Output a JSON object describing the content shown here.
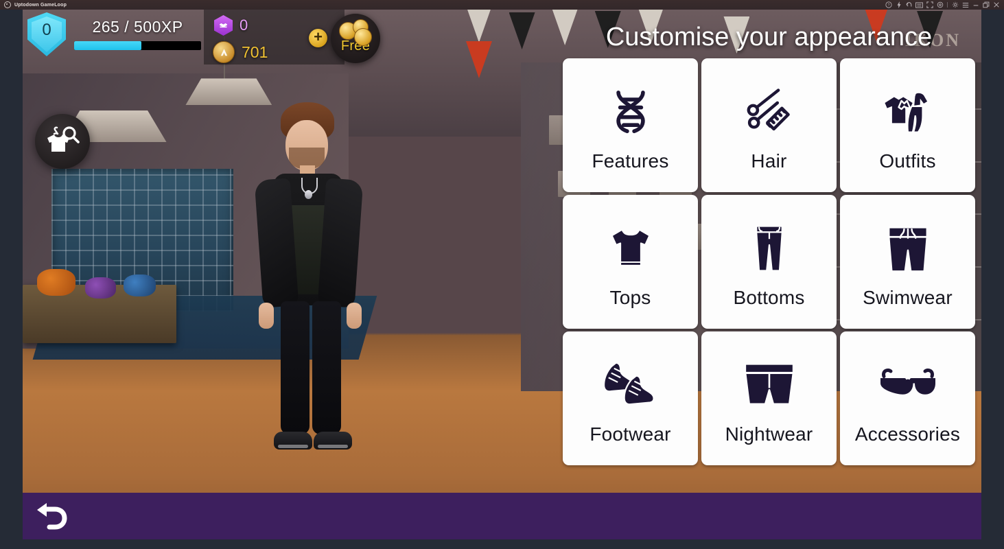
{
  "window": {
    "title": "Uptodown GameLoop",
    "logo_icon": "gameloop-logo-icon",
    "toolbar_icons": [
      {
        "name": "help-icon",
        "glyph": "?"
      },
      {
        "name": "flash-icon",
        "glyph": "lightning"
      },
      {
        "name": "back-arrow-icon",
        "glyph": "undo"
      },
      {
        "name": "keyboard-mapping-icon",
        "glyph": "keyboard"
      },
      {
        "name": "fullscreen-icon",
        "glyph": "expand"
      },
      {
        "name": "settings-icon",
        "glyph": "gear"
      },
      {
        "name": "pin-icon",
        "glyph": "pin"
      },
      {
        "name": "menu-icon",
        "glyph": "menu"
      },
      {
        "name": "minimize-icon",
        "glyph": "minus"
      },
      {
        "name": "restore-icon",
        "glyph": "restore"
      },
      {
        "name": "close-icon",
        "glyph": "x"
      }
    ]
  },
  "hud": {
    "level": "0",
    "xp_text": "265 / 500XP",
    "xp_current": 265,
    "xp_max": 500,
    "xp_percent": 53,
    "gem_value": "0",
    "coin_value": "701",
    "plus_label": "+",
    "free_label": "Free",
    "xp_bar_color": "#2cc6ee",
    "gem_color": "#b444e0",
    "coin_color": "#f1c232"
  },
  "scene": {
    "search_button_name": "outfit-search-button",
    "shop_sign_text": "IKON",
    "avatar_name": "player-avatar"
  },
  "panel": {
    "title": "Customise your appearance",
    "categories": [
      {
        "label": "Features",
        "icon": "dna-icon"
      },
      {
        "label": "Hair",
        "icon": "scissors-comb-icon"
      },
      {
        "label": "Outfits",
        "icon": "outfit-set-icon"
      },
      {
        "label": "Tops",
        "icon": "tshirt-icon"
      },
      {
        "label": "Bottoms",
        "icon": "jeans-icon"
      },
      {
        "label": "Swimwear",
        "icon": "swim-shorts-icon"
      },
      {
        "label": "Footwear",
        "icon": "sneakers-icon"
      },
      {
        "label": "Nightwear",
        "icon": "boxer-shorts-icon"
      },
      {
        "label": "Accessories",
        "icon": "sunglasses-icon"
      }
    ],
    "card_bg": "#fdfdfd",
    "icon_color": "#1d1635"
  },
  "bottom": {
    "back_icon": "back-arrow-icon",
    "bar_color": "#3d1f5e"
  }
}
